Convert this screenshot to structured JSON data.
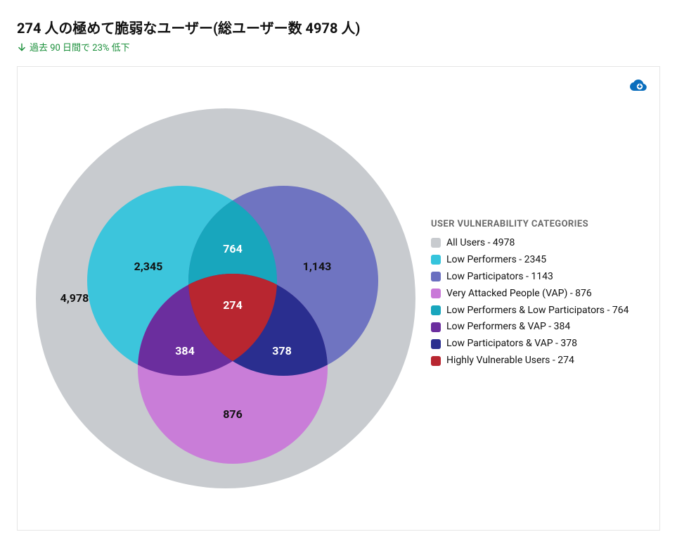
{
  "header": {
    "title": "274 人の極めて脆弱なユーザー(総ユーザー数 4978 人)",
    "subtitle": "過去 90 日間で 23% 低下"
  },
  "legend": {
    "title": "USER VULNERABILITY CATEGORIES",
    "items": [
      {
        "label": "All Users - 4978",
        "color": "#c8cbcf"
      },
      {
        "label": "Low Performers - 2345",
        "color": "#35c4dc"
      },
      {
        "label": "Low Participators - 1143",
        "color": "#6a6fc0"
      },
      {
        "label": "Very Attacked People (VAP) - 876",
        "color": "#c978d8"
      },
      {
        "label": "Low Performers & Low Participators - 764",
        "color": "#18a6bd"
      },
      {
        "label": "Low Performers & VAP - 384",
        "color": "#6b2e9e"
      },
      {
        "label": "Low Participators & VAP - 378",
        "color": "#2a2e8f"
      },
      {
        "label": "Highly Vulnerable Users - 274",
        "color": "#b82630"
      }
    ]
  },
  "chart_data": {
    "type": "venn",
    "title": "User Vulnerability Categories",
    "universe": {
      "name": "All Users",
      "value": 4978,
      "display": "4,978",
      "color": "#c8cbcf"
    },
    "sets": [
      {
        "name": "Low Performers",
        "value": 2345,
        "display": "2,345",
        "color": "#35c4dc"
      },
      {
        "name": "Low Participators",
        "value": 1143,
        "display": "1,143",
        "color": "#6a6fc0"
      },
      {
        "name": "Very Attacked People (VAP)",
        "value": 876,
        "display": "876",
        "color": "#c978d8"
      }
    ],
    "intersections": [
      {
        "sets": [
          "Low Performers",
          "Low Participators"
        ],
        "name": "Low Performers & Low Participators",
        "value": 764,
        "display": "764",
        "color": "#18a6bd"
      },
      {
        "sets": [
          "Low Performers",
          "Very Attacked People (VAP)"
        ],
        "name": "Low Performers & VAP",
        "value": 384,
        "display": "384",
        "color": "#6b2e9e"
      },
      {
        "sets": [
          "Low Participators",
          "Very Attacked People (VAP)"
        ],
        "name": "Low Participators & VAP",
        "value": 378,
        "display": "378",
        "color": "#2a2e8f"
      },
      {
        "sets": [
          "Low Performers",
          "Low Participators",
          "Very Attacked People (VAP)"
        ],
        "name": "Highly Vulnerable Users",
        "value": 274,
        "display": "274",
        "color": "#b82630"
      }
    ]
  }
}
